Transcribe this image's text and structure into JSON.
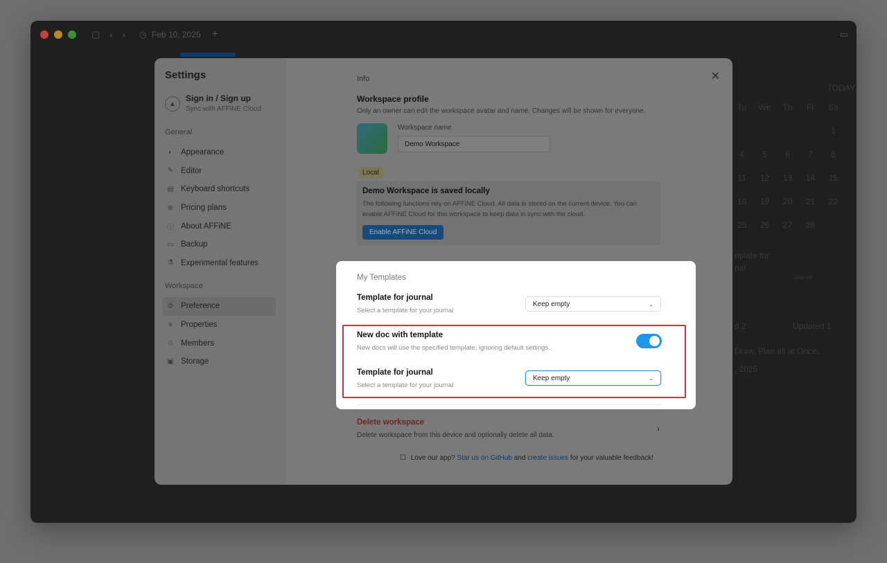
{
  "titlebar": {
    "tab_title": "Feb 10, 2025"
  },
  "settings": {
    "title": "Settings",
    "account": {
      "name": "Sign in / Sign up",
      "subtitle": "Sync with AFFiNE Cloud"
    },
    "general_label": "General",
    "general_items": [
      {
        "label": "Appearance",
        "icon": "palette-icon"
      },
      {
        "label": "Editor",
        "icon": "pen-icon"
      },
      {
        "label": "Keyboard shortcuts",
        "icon": "keyboard-icon"
      },
      {
        "label": "Pricing plans",
        "icon": "pricing-icon"
      },
      {
        "label": "About AFFiNE",
        "icon": "info-icon"
      },
      {
        "label": "Backup",
        "icon": "folder-icon"
      },
      {
        "label": "Experimental features",
        "icon": "flask-icon"
      }
    ],
    "workspace_label": "Workspace",
    "workspace_items": [
      {
        "label": "Preference",
        "icon": "gear-icon"
      },
      {
        "label": "Properties",
        "icon": "list-icon"
      },
      {
        "label": "Members",
        "icon": "members-icon"
      },
      {
        "label": "Storage",
        "icon": "storage-icon"
      }
    ],
    "main": {
      "info_label": "Info",
      "profile_title": "Workspace profile",
      "profile_desc": "Only an owner can edit the workspace avatar and name. Changes will be shown for everyone.",
      "workspace_name_label": "Workspace name",
      "workspace_name_value": "Demo Workspace",
      "local_badge": "Local",
      "local_title": "Demo Workspace is saved locally",
      "local_desc": "The following functions rely on AFFiNE Cloud. All data is stored on the current device. You can enable AFFiNE Cloud for this workspace to keep data in sync with the cloud.",
      "enable_cloud_label": "Enable AFFiNE Cloud",
      "delete_title": "Delete workspace",
      "delete_desc": "Delete workspace from this device and optionally delete all data.",
      "feedback_prefix": "Love our app?",
      "feedback_link1": "Star us on GitHub",
      "feedback_and": "and",
      "feedback_link2": "create issues",
      "feedback_suffix": "for your valuable feedback!"
    }
  },
  "templates": {
    "section_label": "My Templates",
    "journal_title": "Template for journal",
    "journal_desc": "Select a template for your journal",
    "journal_value": "Keep empty",
    "newdoc_title": "New doc with template",
    "newdoc_desc": "New docs will use the specified template, ignoring default settings.",
    "newdoc_enabled": true,
    "journal2_title": "Template for journal",
    "journal2_desc": "Select a template for your journal",
    "journal2_value": "Keep empty"
  },
  "background": {
    "today_label": "TODAY",
    "weekdays": [
      "Tu",
      "We",
      "Th",
      "Fr",
      "Sa"
    ],
    "rows": [
      [
        "",
        "",
        "",
        "",
        "1"
      ],
      [
        "4",
        "5",
        "6",
        "7",
        "8"
      ],
      [
        "11",
        "12",
        "13",
        "14",
        "15"
      ],
      [
        "18",
        "19",
        "20",
        "21",
        "22"
      ],
      [
        "25",
        "26",
        "27",
        "28",
        ""
      ]
    ],
    "snippet1": "nplate for",
    "snippet2": "nal",
    "snippet3": "d 2",
    "snippet4": "Updated 1",
    "snippet5": "Draw, Plan all at Once.",
    "snippet6": ", 2025",
    "journal_thumb": "Journal"
  },
  "colors": {
    "accent": "#1e96eb",
    "highlight": "#e0263c",
    "danger": "#e5483d",
    "link": "#1e6fd0"
  }
}
